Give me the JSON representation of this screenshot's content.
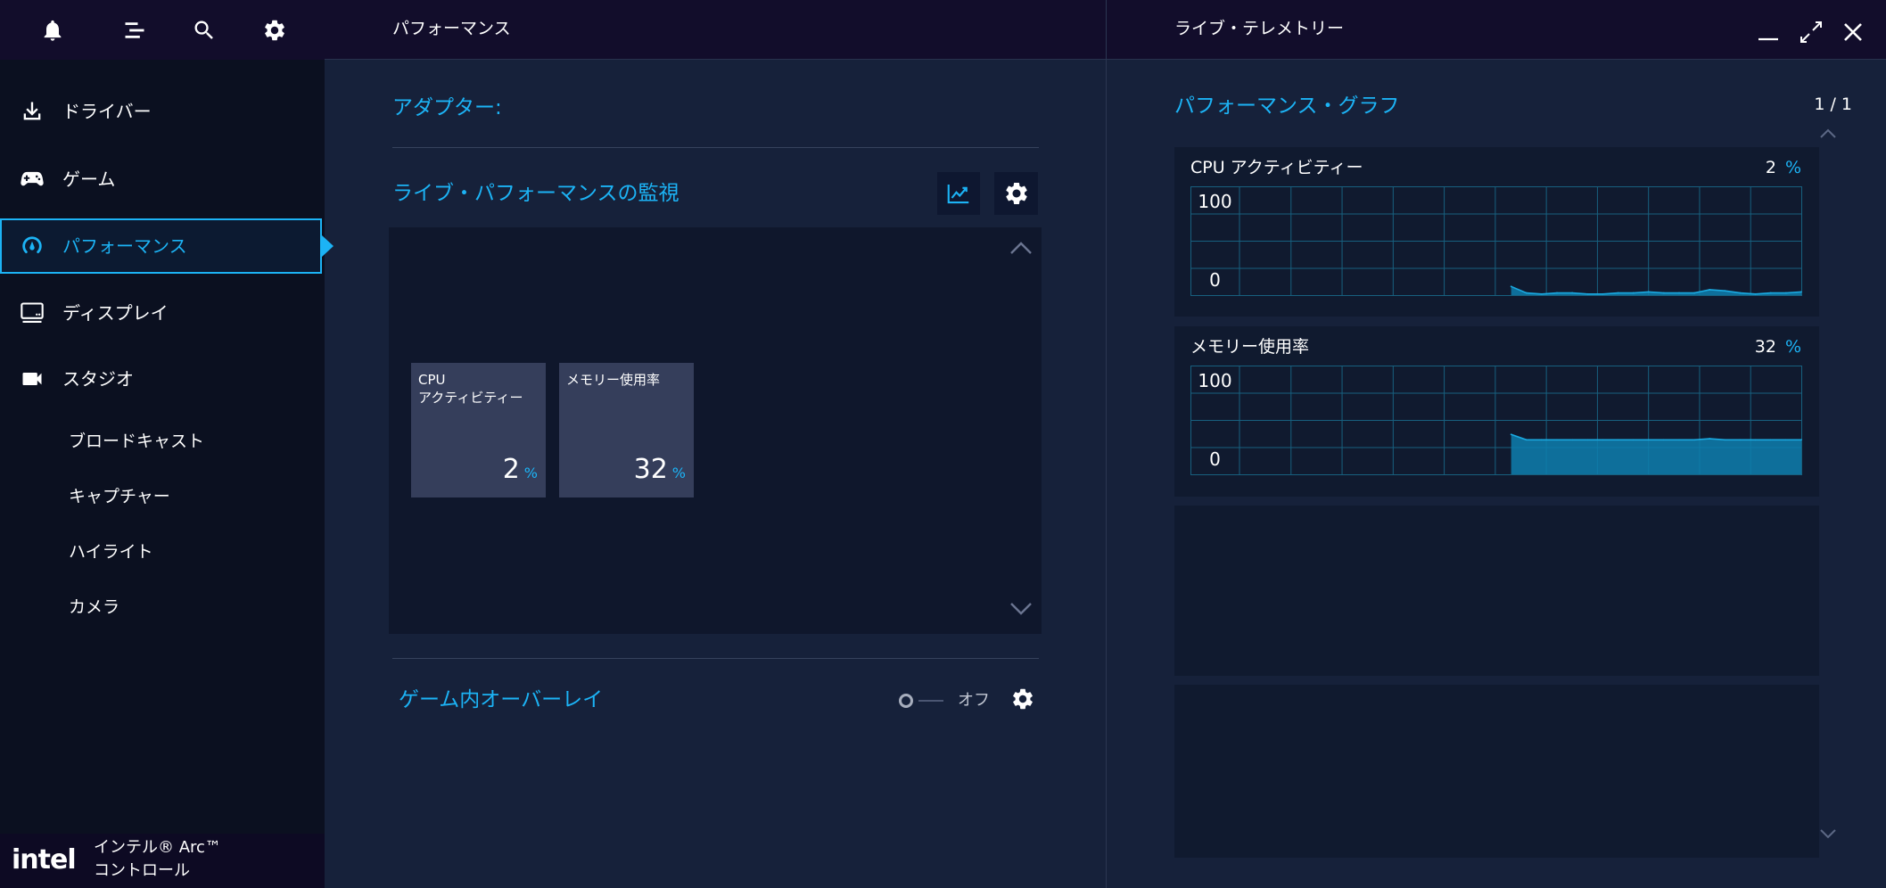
{
  "colors": {
    "accent": "#1cb3f5",
    "titlebar_bg": "#120d2b",
    "sidebar_bg": "#0b1020",
    "panel_bg": "#16213a",
    "monitor_box_bg": "#0f172c",
    "tile_bg": "#353e5b",
    "card_bg": "#101a2f",
    "graph_grid": "#17607f",
    "graph_line": "#1aa9e0",
    "graph_fill": "#0e7fae"
  },
  "titlebar": {
    "icons": [
      "bell-icon",
      "menu-icon",
      "search-icon",
      "gear-icon"
    ],
    "main_title": "パフォーマンス",
    "telemetry_title": "ライブ・テレメトリー",
    "window_controls": [
      "minimize-icon",
      "expand-icon",
      "close-icon"
    ]
  },
  "sidebar": {
    "items": [
      {
        "label": "ドライバー",
        "icon": "download-icon"
      },
      {
        "label": "ゲーム",
        "icon": "gamepad-icon"
      },
      {
        "label": "パフォーマンス",
        "icon": "performance-gauge-icon",
        "selected": true
      },
      {
        "label": "ディスプレイ",
        "icon": "display-icon"
      },
      {
        "label": "スタジオ",
        "icon": "video-camera-icon"
      }
    ],
    "studio_subitems": [
      "ブロードキャスト",
      "キャプチャー",
      "ハイライト",
      "カメラ"
    ]
  },
  "brand": {
    "logo": "intel",
    "line1": "インテル® Arc™",
    "line2": "コントロール"
  },
  "performance": {
    "adapter_label": "アダプター:",
    "monitor_title": "ライブ・パフォーマンスの監視",
    "monitor_buttons": [
      "chart-icon",
      "gear-icon"
    ],
    "tiles": [
      {
        "label_lines": [
          "CPU",
          "アクティビティー"
        ],
        "value": "2",
        "unit": "%"
      },
      {
        "label_lines": [
          "メモリー使用率"
        ],
        "value": "32",
        "unit": "%"
      }
    ],
    "overlay": {
      "title": "ゲーム内オーバーレイ",
      "toggle_label": "オフ",
      "enabled": false
    }
  },
  "telemetry": {
    "section_title": "パフォーマンス・グラフ",
    "page_indicator": "1 / 1",
    "graphs": [
      {
        "name": "CPU アクティビティー",
        "value": "2",
        "unit": "%",
        "y_max_label": "100",
        "y_min_label": "0",
        "ylim": [
          0,
          100
        ],
        "samples": [
          null,
          null,
          null,
          null,
          null,
          null,
          null,
          null,
          null,
          null,
          null,
          null,
          null,
          null,
          null,
          null,
          null,
          null,
          null,
          null,
          null,
          8,
          2,
          1,
          2,
          2,
          1,
          1,
          2,
          2,
          3,
          2,
          2,
          2,
          5,
          4,
          2,
          1,
          2,
          2,
          3
        ]
      },
      {
        "name": "メモリー使用率",
        "value": "32",
        "unit": "%",
        "y_max_label": "100",
        "y_min_label": "0",
        "ylim": [
          0,
          100
        ],
        "samples": [
          null,
          null,
          null,
          null,
          null,
          null,
          null,
          null,
          null,
          null,
          null,
          null,
          null,
          null,
          null,
          null,
          null,
          null,
          null,
          null,
          null,
          37,
          32,
          32,
          32,
          32,
          32,
          32,
          32,
          32,
          32,
          32,
          32,
          32,
          33,
          32,
          32,
          32,
          32,
          32,
          32
        ]
      }
    ]
  }
}
